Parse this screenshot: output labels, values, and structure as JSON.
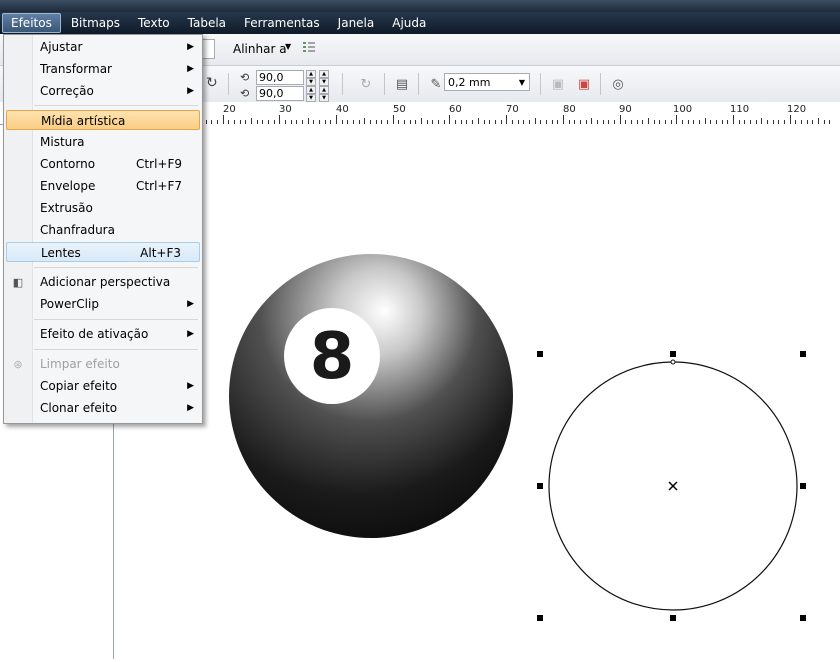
{
  "menubar": {
    "items": [
      {
        "label": "Efeitos",
        "active": true
      },
      {
        "label": "Bitmaps",
        "active": false
      },
      {
        "label": "Texto",
        "active": false
      },
      {
        "label": "Tabela",
        "active": false
      },
      {
        "label": "Ferramentas",
        "active": false
      },
      {
        "label": "Janela",
        "active": false
      },
      {
        "label": "Ajuda",
        "active": false
      }
    ]
  },
  "toolbar": {
    "align_label": "Alinhar a",
    "rotation_x": "90,0",
    "rotation_y": "90,0",
    "outline_width": "0,2 mm"
  },
  "ruler": {
    "labels": [
      "20",
      "30",
      "40",
      "50",
      "60",
      "70",
      "80",
      "90",
      "100",
      "110",
      "120"
    ]
  },
  "dropdown": {
    "items": [
      {
        "label": "Ajustar",
        "shortcut": "",
        "submenu": true,
        "state": "normal"
      },
      {
        "label": "Transformar",
        "shortcut": "",
        "submenu": true,
        "state": "normal"
      },
      {
        "label": "Correção",
        "shortcut": "",
        "submenu": true,
        "state": "normal"
      },
      {
        "label": "Mídia artística",
        "shortcut": "",
        "submenu": false,
        "state": "highlight"
      },
      {
        "label": "Mistura",
        "shortcut": "",
        "submenu": false,
        "state": "normal"
      },
      {
        "label": "Contorno",
        "shortcut": "Ctrl+F9",
        "submenu": false,
        "state": "normal"
      },
      {
        "label": "Envelope",
        "shortcut": "Ctrl+F7",
        "submenu": false,
        "state": "normal"
      },
      {
        "label": "Extrusão",
        "shortcut": "",
        "submenu": false,
        "state": "normal"
      },
      {
        "label": "Chanfradura",
        "shortcut": "",
        "submenu": false,
        "state": "normal"
      },
      {
        "label": "Lentes",
        "shortcut": "Alt+F3",
        "submenu": false,
        "state": "hover"
      },
      {
        "label": "Adicionar perspectiva",
        "shortcut": "",
        "submenu": false,
        "state": "normal"
      },
      {
        "label": "PowerClip",
        "shortcut": "",
        "submenu": true,
        "state": "normal"
      },
      {
        "label": "Efeito de ativação",
        "shortcut": "",
        "submenu": true,
        "state": "normal"
      },
      {
        "label": "Limpar efeito",
        "shortcut": "",
        "submenu": false,
        "state": "disabled"
      },
      {
        "label": "Copiar efeito",
        "shortcut": "",
        "submenu": true,
        "state": "normal"
      },
      {
        "label": "Clonar efeito",
        "shortcut": "",
        "submenu": true,
        "state": "normal"
      }
    ]
  },
  "canvas": {
    "ball_number": "8"
  }
}
